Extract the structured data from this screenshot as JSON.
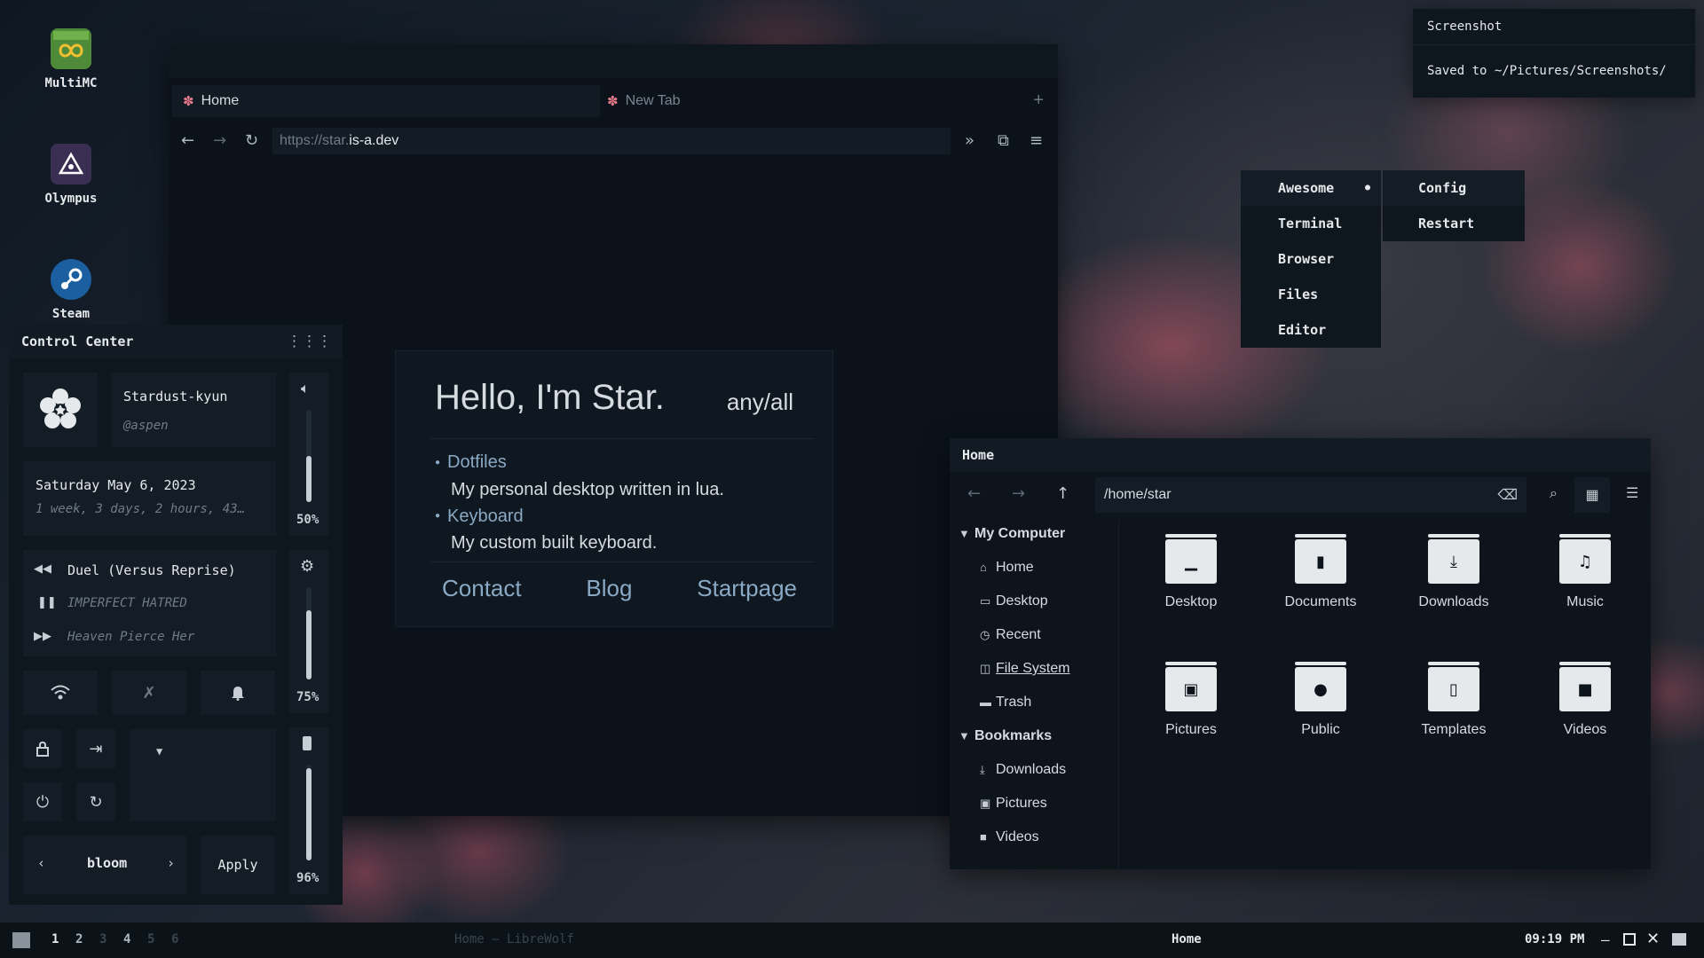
{
  "desktop": {
    "icons": [
      {
        "label": "MultiMC",
        "icon": "multimc-icon"
      },
      {
        "label": "Olympus",
        "icon": "olympus-icon"
      },
      {
        "label": "Steam",
        "icon": "steam-icon"
      }
    ]
  },
  "browser": {
    "tabs": [
      {
        "label": "Home",
        "active": true
      },
      {
        "label": "New Tab",
        "active": false
      }
    ],
    "url_dim": "https://star.",
    "url_main": "is-a.dev",
    "page": {
      "title": "Hello, I'm Star.",
      "tag": "any/all",
      "items": [
        {
          "link": "Dotfiles",
          "desc": "My personal desktop written in lua."
        },
        {
          "link": "Keyboard",
          "desc": "My custom built keyboard."
        }
      ],
      "links": [
        "Contact",
        "Blog",
        "Startpage"
      ]
    }
  },
  "control_center": {
    "title": "Control Center",
    "user": {
      "name": "Stardust-kyun",
      "handle": "@aspen"
    },
    "date": "Saturday May  6, 2023",
    "uptime": "1 week, 3 days, 2 hours, 43…",
    "music": {
      "title": "Duel (Versus Reprise)",
      "album": "IMPERFECT HATRED",
      "artist": "Heaven Pierce Her"
    },
    "volume": {
      "label": "50%",
      "value": 50
    },
    "brightness": {
      "label": "75%",
      "value": 75
    },
    "battery": {
      "label": "96%",
      "value": 96
    },
    "theme": {
      "name": "bloom",
      "apply": "Apply"
    }
  },
  "notification": {
    "title": "Screenshot",
    "body": "Saved to ~/Pictures/Screenshots/"
  },
  "menu": {
    "items": [
      "Awesome",
      "Terminal",
      "Browser",
      "Files",
      "Editor"
    ],
    "submenu": [
      "Config",
      "Restart"
    ]
  },
  "file_manager": {
    "title": "Home",
    "path": "/home/star",
    "sections": [
      {
        "header": "My Computer",
        "items": [
          {
            "label": "Home",
            "icon": "home-icon"
          },
          {
            "label": "Desktop",
            "icon": "desktop-icon"
          },
          {
            "label": "Recent",
            "icon": "clock-icon"
          },
          {
            "label": "File System",
            "icon": "drive-icon"
          },
          {
            "label": "Trash",
            "icon": "trash-icon"
          }
        ]
      },
      {
        "header": "Bookmarks",
        "items": [
          {
            "label": "Downloads",
            "icon": "download-icon"
          },
          {
            "label": "Pictures",
            "icon": "image-icon"
          },
          {
            "label": "Videos",
            "icon": "video-icon"
          }
        ]
      }
    ],
    "folders": [
      {
        "label": "Desktop",
        "icon": "desktop-folder-icon"
      },
      {
        "label": "Documents",
        "icon": "document-folder-icon"
      },
      {
        "label": "Downloads",
        "icon": "download-folder-icon"
      },
      {
        "label": "Music",
        "icon": "music-folder-icon"
      },
      {
        "label": "Pictures",
        "icon": "pictures-folder-icon"
      },
      {
        "label": "Public",
        "icon": "public-folder-icon"
      },
      {
        "label": "Templates",
        "icon": "templates-folder-icon"
      },
      {
        "label": "Videos",
        "icon": "videos-folder-icon"
      }
    ]
  },
  "taskbar": {
    "workspaces": [
      "1",
      "2",
      "3",
      "4",
      "5",
      "6"
    ],
    "window_title": "Home — LibreWolf",
    "center_title": "Home",
    "clock": "09:19 PM"
  }
}
